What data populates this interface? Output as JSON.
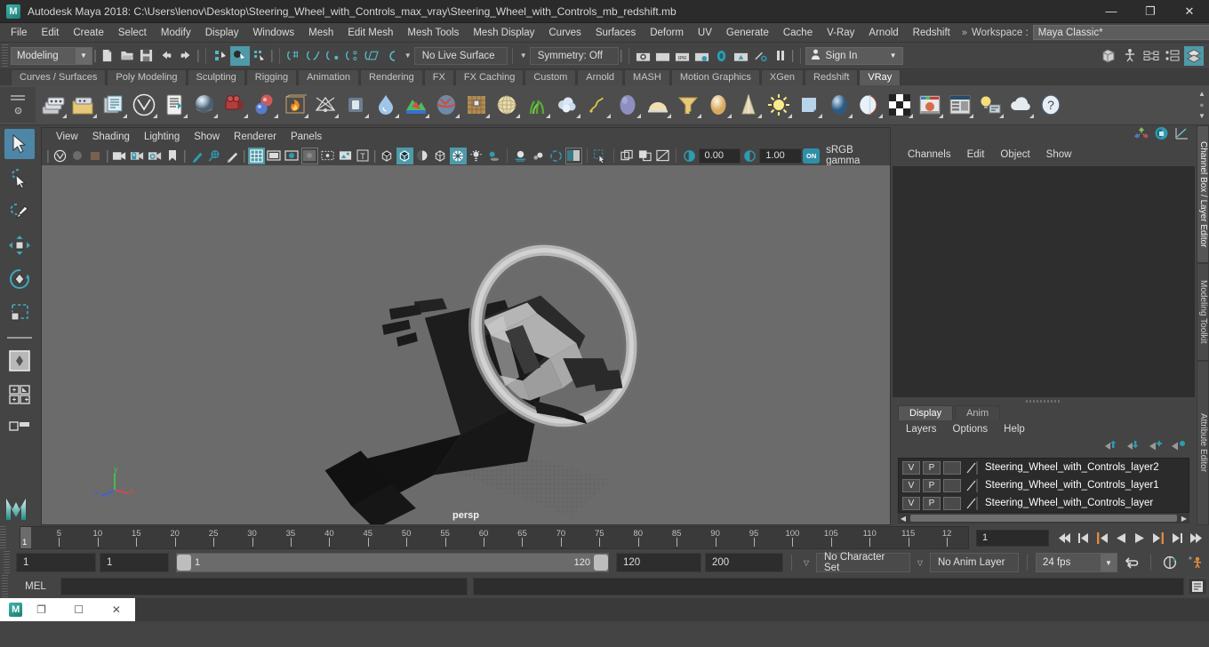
{
  "window": {
    "title": "Autodesk Maya 2018: C:\\Users\\lenov\\Desktop\\Steering_Wheel_with_Controls_max_vray\\Steering_Wheel_with_Controls_mb_redshift.mb",
    "logo": "M",
    "minimize": "—",
    "restore": "❐",
    "close": "✕"
  },
  "menubar": {
    "items": [
      "File",
      "Edit",
      "Create",
      "Select",
      "Modify",
      "Display",
      "Windows",
      "Mesh",
      "Edit Mesh",
      "Mesh Tools",
      "Mesh Display",
      "Curves",
      "Surfaces",
      "Deform",
      "UV",
      "Generate",
      "Cache",
      "V-Ray",
      "Arnold",
      "Redshift"
    ],
    "overflow_chevrons": "»",
    "workspace_label": "Workspace :",
    "workspace_value": "Maya Classic*",
    "lock_icon": "lock-icon"
  },
  "statusbar": {
    "mode_value": "Modeling",
    "live_surface_value": "No Live Surface",
    "symmetry_value": "Symmetry: Off",
    "signin_label": "Sign In",
    "icons": [
      "new-scene-icon",
      "open-scene-icon",
      "save-scene-icon",
      "undo-icon",
      "redo-icon",
      "select-by-hierarchy-icon",
      "select-by-object-icon",
      "select-by-component-icon",
      "snap-to-grid-icon",
      "snap-to-curve-icon",
      "snap-to-point-icon",
      "snap-to-projected-center-icon",
      "snap-to-view-plane-icon",
      "make-live-icon",
      "render-current-frame-icon",
      "render-sequence-icon",
      "ipr-render-icon",
      "render-settings-icon",
      "hypershade-icon",
      "render-view-icon",
      "toggle-render-icon",
      "pause-render-icon",
      "show-hide-modeling-toolkit-icon",
      "show-hide-hud-icon",
      "show-hide-attribute-editor-icon",
      "show-hide-tool-settings-icon",
      "show-hide-channel-box-icon"
    ]
  },
  "shelf": {
    "tabs": [
      "Curves / Surfaces",
      "Poly Modeling",
      "Sculpting",
      "Rigging",
      "Animation",
      "Rendering",
      "FX",
      "FX Caching",
      "Custom",
      "Arnold",
      "MASH",
      "Motion Graphics",
      "XGen",
      "Redshift",
      "VRay"
    ],
    "active_tab": "VRay",
    "icons": [
      "vray-save-render-elements-icon",
      "vray-load-render-elements-icon",
      "vray-render-elements-list-icon",
      "vray-logo-icon",
      "vray-vfb-icon",
      "vray-material-icon",
      "vray-camera-icon",
      "vray-blend-material-icon",
      "vray-fire-volume-icon",
      "vray-light-dome-icon",
      "vray-light-rect-icon",
      "vray-water-icon",
      "vray-displacement-icon",
      "vray-fur-icon",
      "vray-grid-texture-icon",
      "vray-dome-light-icon",
      "vray-grass-icon",
      "vray-clouds-icon",
      "vray-hair-icon",
      "vray-sphere-light-icon",
      "vray-ies-light-icon",
      "vray-mesh-light-icon",
      "vray-sphere-fade-icon",
      "vray-cone-light-icon",
      "vray-sun-icon",
      "vray-plane-icon",
      "vray-sphere-icon",
      "vray-fresnel-icon",
      "vray-checker-icon",
      "vray-frame-buffer-icon",
      "vray-render-settings-icon",
      "vray-light-lister-icon",
      "vray-cloud-icon",
      "vray-help-icon"
    ],
    "scroll_up": "▲",
    "scroll_down": "▼",
    "menu_grip": "shelf-menu-icon",
    "settings": "shelf-settings-icon"
  },
  "lefttools": {
    "items": [
      {
        "name": "select-tool",
        "selected": true
      },
      {
        "name": "lasso-select-tool",
        "selected": false
      },
      {
        "name": "paint-select-tool",
        "selected": false
      },
      {
        "name": "move-tool",
        "selected": false
      },
      {
        "name": "rotate-tool",
        "selected": false
      },
      {
        "name": "scale-tool",
        "selected": false
      }
    ],
    "layouts": [
      {
        "name": "single-perspective-view-layout"
      },
      {
        "name": "four-view-layout"
      },
      {
        "name": "two-pane-layout"
      }
    ],
    "maya-logo": "M"
  },
  "viewport": {
    "menu": [
      "View",
      "Shading",
      "Lighting",
      "Show",
      "Renderer",
      "Panels"
    ],
    "camera_label": "persp",
    "gamma_label": "sRGB gamma",
    "exposure_value": "0.00",
    "gamma_value": "1.00",
    "gamma_toggle": "ON",
    "axes": {
      "x": "x",
      "y": "y",
      "z": "z"
    },
    "toolbar_icons": [
      "select-camera-icon",
      "lock-camera-icon",
      "camera-attributes-icon",
      "bookmark-icon",
      "image-plane-icon",
      "two-d-pan-zoom-icon",
      "grease-pencil-icon",
      "grid-icon",
      "film-gate-icon",
      "resolution-gate-icon",
      "gate-mask-icon",
      "xray-icon",
      "xray-joints-icon",
      "texture-border-icon",
      "wireframe-icon",
      "smooth-shade-all-icon",
      "shade-x-ray-icon",
      "flat-shade-icon",
      "wireframe-on-shaded-icon",
      "textured-icon",
      "use-all-lights-icon",
      "shadows-icon",
      "screen-space-ao-icon",
      "motion-blur-icon",
      "multisample-icon",
      "depth-of-field-icon",
      "isolate-select-icon",
      "single-pane-icon",
      "panel-layout-icon",
      "no-image-icon",
      "exposure-icon",
      "gamma-icon"
    ]
  },
  "channelbox": {
    "menu": [
      "Channels",
      "Edit",
      "Object",
      "Show"
    ],
    "header_icons": [
      "show-channel-box-icon",
      "show-attribute-editor-icon",
      "show-graph-editor-icon"
    ],
    "side_tabs": [
      "Channel Box / Layer Editor",
      "Modeling Toolkit",
      "Attribute Editor"
    ],
    "active_side_tab": "Channel Box / Layer Editor"
  },
  "layer_editor": {
    "tabs": [
      "Display",
      "Anim"
    ],
    "active_tab": "Display",
    "menu": [
      "Layers",
      "Options",
      "Help"
    ],
    "buttons": [
      "move-layer-up-icon",
      "move-layer-down-icon",
      "new-layer-icon",
      "new-layer-from-selected-icon"
    ],
    "columns": {
      "visible": "V",
      "playback": "P",
      "state": ""
    },
    "layers": [
      {
        "v": "V",
        "p": "P",
        "state": "",
        "name": "Steering_Wheel_with_Controls_layer2"
      },
      {
        "v": "V",
        "p": "P",
        "state": "",
        "name": "Steering_Wheel_with_Controls_layer1"
      },
      {
        "v": "V",
        "p": "P",
        "state": "",
        "name": "Steering_Wheel_with_Controls_layer"
      }
    ],
    "scroll_left": "◀",
    "scroll_right": "▶"
  },
  "timeline": {
    "ticks": [
      "5",
      "10",
      "15",
      "20",
      "25",
      "30",
      "35",
      "40",
      "45",
      "50",
      "55",
      "60",
      "65",
      "70",
      "75",
      "80",
      "85",
      "90",
      "95",
      "100",
      "105",
      "110",
      "115",
      "12"
    ],
    "start": 1,
    "end": 120,
    "current_frame_marker": "1",
    "current_frame_field": "1",
    "transport": [
      "go-to-start-icon",
      "step-back-keyframe-icon",
      "step-back-frame-icon",
      "play-backwards-icon",
      "play-forwards-icon",
      "step-forward-frame-icon",
      "step-forward-keyframe-icon",
      "go-to-end-icon"
    ]
  },
  "range": {
    "anim_start": "1",
    "range_start": "1",
    "slider_start": "1",
    "slider_end": "120",
    "range_end": "120",
    "anim_end": "200",
    "character_set": "No Character Set",
    "anim_layer": "No Anim Layer",
    "fps": "24 fps",
    "icons": [
      "auto-key-icon",
      "animation-preferences-icon",
      "playback-loop-icon"
    ]
  },
  "command_line": {
    "language_label": "MEL",
    "input_value": "",
    "input_placeholder": "",
    "output_value": "",
    "script_editor_icon": "script-editor-icon"
  },
  "taskbar": {
    "app_logo": "M",
    "restore_icon": "❐",
    "maximize_icon": "☐",
    "close_icon": "✕"
  },
  "colors": {
    "accent": "#4e9aa8",
    "selected_tool": "#4e86a8",
    "viewport_bg": "#6b6b6b",
    "panel_bg": "#444444",
    "field_bg": "#2d2d2d",
    "axis_x": "#d64b4b",
    "axis_y": "#49c24e",
    "axis_z": "#3b63d6",
    "orange_marker": "#e08a3c"
  }
}
